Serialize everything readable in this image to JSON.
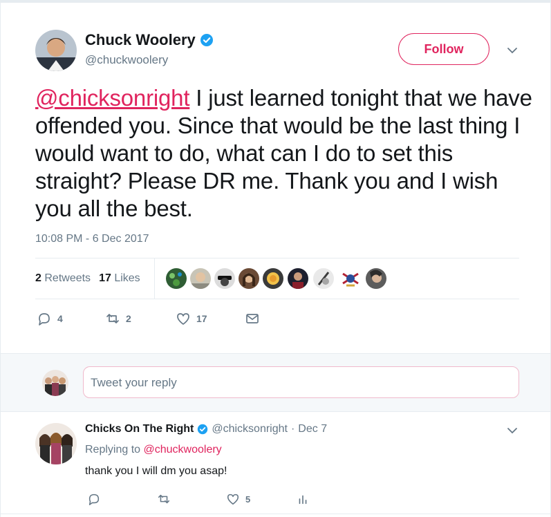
{
  "tweet": {
    "author_name": "Chuck Woolery",
    "author_handle": "@chuckwoolery",
    "follow_label": "Follow",
    "mention": "@chicksonright",
    "text_after_mention": " I just learned tonight that we have offended you. Since that would be the last thing I would want to do, what can I do to set this straight? Please DR me. Thank you and I wish you all the best.",
    "timestamp": "10:08 PM - 6 Dec 2017",
    "retweets_count": "2",
    "retweets_label": "Retweets",
    "likes_count": "17",
    "likes_label": "Likes",
    "actions": {
      "replies": "4",
      "retweets": "2",
      "likes": "17"
    }
  },
  "reply_box": {
    "placeholder": "Tweet your reply"
  },
  "reply": {
    "author_name": "Chicks On The Right",
    "author_handle": "@chicksonright",
    "separator": "·",
    "date": "Dec 7",
    "replying_prefix": "Replying to",
    "replying_to": "@chuckwoolery",
    "text": "thank you I will dm you asap!",
    "actions": {
      "likes": "5"
    }
  },
  "colors": {
    "accent": "#e0245e",
    "verified": "#1da1f2",
    "muted": "#657786"
  },
  "icons": [
    "verified-badge-icon",
    "chevron-down-icon",
    "reply-icon",
    "retweet-icon",
    "heart-icon",
    "message-icon",
    "analytics-icon"
  ]
}
